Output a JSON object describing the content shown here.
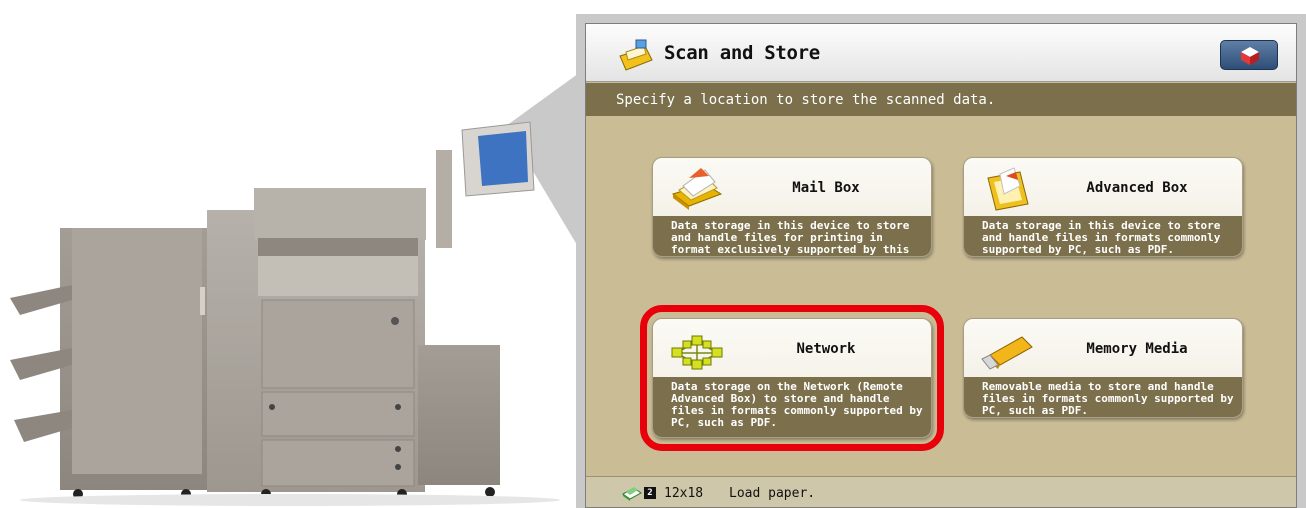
{
  "screen": {
    "title": "Scan and Store",
    "instruction": "Specify a location to store the scanned data."
  },
  "destinations": [
    {
      "label": "Mail Box",
      "description": "Data storage in this device to store and handle files for printing in format exclusively supported by this device.",
      "icon": "mailbox-icon"
    },
    {
      "label": "Advanced Box",
      "description": "Data storage in this device to store and handle files in formats commonly supported by PC, such as PDF.",
      "icon": "advanced-box-icon"
    },
    {
      "label": "Network",
      "description": "Data storage on the Network (Remote Advanced Box) to store and handle files in formats commonly supported by PC, such as PDF.",
      "icon": "network-icon",
      "highlighted": true
    },
    {
      "label": "Memory Media",
      "description": "Removable media to store and handle files in formats commonly supported by PC, such as PDF.",
      "icon": "usb-drive-icon"
    }
  ],
  "status": {
    "drawer": "2",
    "paper_size": "12x18",
    "message": "Load paper."
  },
  "colors": {
    "screen_background": "#cabd96",
    "bar_brown": "#7b6f4c",
    "highlight": "#e8000b",
    "title_button": "#3b5c85"
  }
}
